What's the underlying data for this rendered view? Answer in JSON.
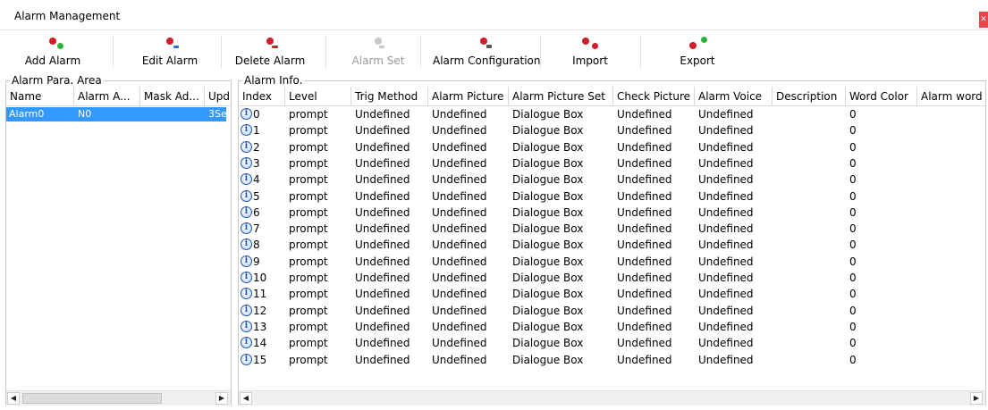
{
  "window": {
    "title": "Alarm Management"
  },
  "toolbar": {
    "add": "Add Alarm",
    "edit": "Edit Alarm",
    "delete": "Delete Alarm",
    "set": "Alarm Set",
    "config": "Alarm Configuration",
    "import": "Import",
    "export": "Export"
  },
  "left_panel": {
    "title": "Alarm Para. Area",
    "columns": [
      "Name",
      "Alarm A...",
      "Mask Ad...",
      "Upd"
    ],
    "row": {
      "name": "Alarm0",
      "alarm_addr": "N0",
      "mask_addr": "",
      "upd": "3Se"
    }
  },
  "right_panel": {
    "title": "Alarm Info.",
    "columns": [
      "Index",
      "Level",
      "Trig Method",
      "Alarm Picture",
      "Alarm Picture Set",
      "Check Picture",
      "Alarm Voice",
      "Description",
      "Word Color",
      "Alarm word"
    ],
    "rows": [
      {
        "index": "0",
        "level": "prompt",
        "trig": "Undefined",
        "picture": "Undefined",
        "picture_set": "Dialogue Box",
        "check": "Undefined",
        "voice": "Undefined",
        "description": "",
        "word_color": "0"
      },
      {
        "index": "1",
        "level": "prompt",
        "trig": "Undefined",
        "picture": "Undefined",
        "picture_set": "Dialogue Box",
        "check": "Undefined",
        "voice": "Undefined",
        "description": "",
        "word_color": "0"
      },
      {
        "index": "2",
        "level": "prompt",
        "trig": "Undefined",
        "picture": "Undefined",
        "picture_set": "Dialogue Box",
        "check": "Undefined",
        "voice": "Undefined",
        "description": "",
        "word_color": "0"
      },
      {
        "index": "3",
        "level": "prompt",
        "trig": "Undefined",
        "picture": "Undefined",
        "picture_set": "Dialogue Box",
        "check": "Undefined",
        "voice": "Undefined",
        "description": "",
        "word_color": "0"
      },
      {
        "index": "4",
        "level": "prompt",
        "trig": "Undefined",
        "picture": "Undefined",
        "picture_set": "Dialogue Box",
        "check": "Undefined",
        "voice": "Undefined",
        "description": "",
        "word_color": "0"
      },
      {
        "index": "5",
        "level": "prompt",
        "trig": "Undefined",
        "picture": "Undefined",
        "picture_set": "Dialogue Box",
        "check": "Undefined",
        "voice": "Undefined",
        "description": "",
        "word_color": "0"
      },
      {
        "index": "6",
        "level": "prompt",
        "trig": "Undefined",
        "picture": "Undefined",
        "picture_set": "Dialogue Box",
        "check": "Undefined",
        "voice": "Undefined",
        "description": "",
        "word_color": "0"
      },
      {
        "index": "7",
        "level": "prompt",
        "trig": "Undefined",
        "picture": "Undefined",
        "picture_set": "Dialogue Box",
        "check": "Undefined",
        "voice": "Undefined",
        "description": "",
        "word_color": "0"
      },
      {
        "index": "8",
        "level": "prompt",
        "trig": "Undefined",
        "picture": "Undefined",
        "picture_set": "Dialogue Box",
        "check": "Undefined",
        "voice": "Undefined",
        "description": "",
        "word_color": "0"
      },
      {
        "index": "9",
        "level": "prompt",
        "trig": "Undefined",
        "picture": "Undefined",
        "picture_set": "Dialogue Box",
        "check": "Undefined",
        "voice": "Undefined",
        "description": "",
        "word_color": "0"
      },
      {
        "index": "10",
        "level": "prompt",
        "trig": "Undefined",
        "picture": "Undefined",
        "picture_set": "Dialogue Box",
        "check": "Undefined",
        "voice": "Undefined",
        "description": "",
        "word_color": "0"
      },
      {
        "index": "11",
        "level": "prompt",
        "trig": "Undefined",
        "picture": "Undefined",
        "picture_set": "Dialogue Box",
        "check": "Undefined",
        "voice": "Undefined",
        "description": "",
        "word_color": "0"
      },
      {
        "index": "12",
        "level": "prompt",
        "trig": "Undefined",
        "picture": "Undefined",
        "picture_set": "Dialogue Box",
        "check": "Undefined",
        "voice": "Undefined",
        "description": "",
        "word_color": "0"
      },
      {
        "index": "13",
        "level": "prompt",
        "trig": "Undefined",
        "picture": "Undefined",
        "picture_set": "Dialogue Box",
        "check": "Undefined",
        "voice": "Undefined",
        "description": "",
        "word_color": "0"
      },
      {
        "index": "14",
        "level": "prompt",
        "trig": "Undefined",
        "picture": "Undefined",
        "picture_set": "Dialogue Box",
        "check": "Undefined",
        "voice": "Undefined",
        "description": "",
        "word_color": "0"
      },
      {
        "index": "15",
        "level": "prompt",
        "trig": "Undefined",
        "picture": "Undefined",
        "picture_set": "Dialogue Box",
        "check": "Undefined",
        "voice": "Undefined",
        "description": "",
        "word_color": "0"
      }
    ]
  },
  "icons": {
    "alarm": "red-bell-dot-icon",
    "info": "info-circle-icon"
  },
  "colors": {
    "selection": "#3399ff",
    "alarm_red": "#cc1f2a",
    "accent_green": "#2fae3a",
    "accent_blue": "#2f6fd0"
  }
}
